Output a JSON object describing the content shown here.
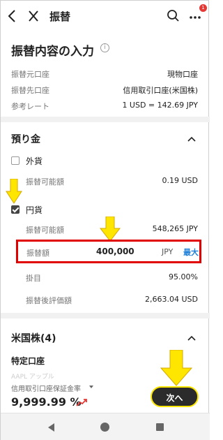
{
  "header": {
    "title": "振替",
    "badge_count": "1"
  },
  "page_title": "振替内容の入力",
  "summary": [
    {
      "label": "振替元口座",
      "value": "現物口座"
    },
    {
      "label": "振替先口座",
      "value": "信用取引口座(米国株)"
    },
    {
      "label": "参考レート",
      "value": "1 USD = 142.69 JPY"
    }
  ],
  "deposit": {
    "title": "預り金",
    "foreign": {
      "label": "外貨",
      "checked": false,
      "available_label": "振替可能額",
      "available_value": "0.19 USD"
    },
    "yen": {
      "label": "円貨",
      "checked": true,
      "available_label": "振替可能額",
      "available_value": "548,265 JPY",
      "amount_label": "振替額",
      "amount_value": "400,000",
      "amount_currency": "JPY",
      "max_label": "最大",
      "rate_label": "掛目",
      "rate_value": "95.00%",
      "after_label": "振替後評価額",
      "after_value": "2,663.04 USD"
    }
  },
  "us_stocks": {
    "title": "米国株(4)",
    "account_label": "特定口座",
    "faded_text": "AAPL アップル"
  },
  "footer": {
    "margin_label": "信用取引口座保証金率",
    "margin_value": "9,999.99 %",
    "next_label": "次へ"
  },
  "colors": {
    "highlight_border": "#e00000",
    "arrow_fill": "#ffe600",
    "link": "#1e7fd8"
  }
}
